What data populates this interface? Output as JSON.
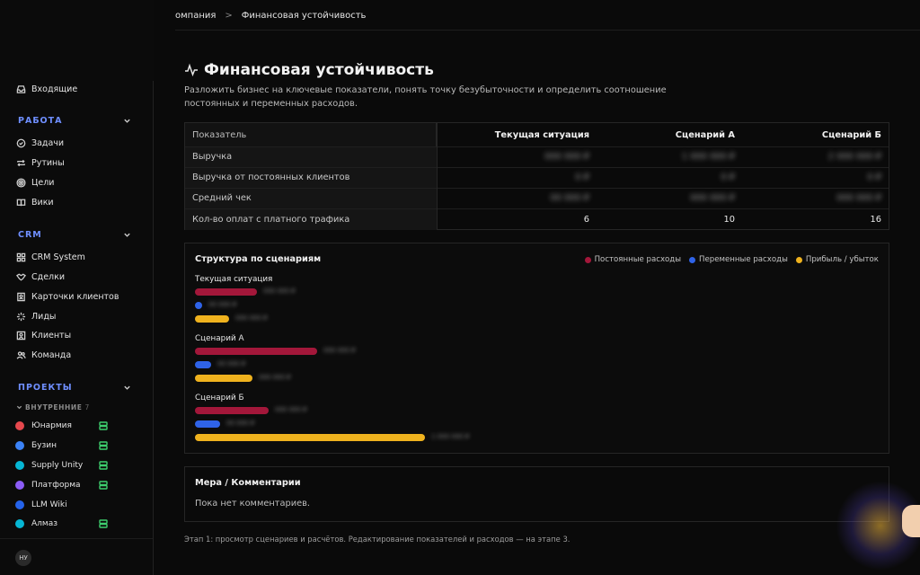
{
  "breadcrumb": {
    "parent": "омпания",
    "separator": ">",
    "current": "Финансовая устойчивость"
  },
  "sidebar": {
    "inbox": "Входящие",
    "work": {
      "title": "РАБОТА",
      "items": [
        "Задачи",
        "Рутины",
        "Цели",
        "Вики"
      ]
    },
    "crm": {
      "title": "CRM",
      "items": [
        "CRM System",
        "Сделки",
        "Карточки клиентов",
        "Лиды",
        "Клиенты",
        "Команда"
      ]
    },
    "projects": {
      "title": "ПРОЕКТЫ",
      "group": "ВНУТРЕННИЕ",
      "group_count": "7",
      "items": [
        {
          "name": "Юнармия",
          "color": "#e5484d",
          "server": true
        },
        {
          "name": "Бузин",
          "color": "#3b82f6",
          "server": true
        },
        {
          "name": "Supply Unity",
          "color": "#06b6d4",
          "server": true
        },
        {
          "name": "Платформа",
          "color": "#8b5cf6",
          "server": true
        },
        {
          "name": "LLM Wiki",
          "color": "#2563eb",
          "server": false
        },
        {
          "name": "Алмаз",
          "color": "#06b6d4",
          "server": true
        }
      ]
    },
    "avatar": "НУ"
  },
  "page": {
    "title": "Финансовая устойчивость",
    "description": "Разложить бизнес на ключевые показатели, понять точку безубыточности и определить соотношение постоянных и переменных расходов."
  },
  "table": {
    "headers": [
      "Показатель",
      "Текущая ситуация",
      "Сценарий А",
      "Сценарий Б"
    ],
    "rows": [
      {
        "label": "Выручка",
        "values": [
          "000 000 ₽",
          "1 000 000 ₽",
          "2 000 000 ₽"
        ],
        "hidden": true
      },
      {
        "label": "Выручка от постоянных клиентов",
        "values": [
          "0 ₽",
          "0 ₽",
          "0 ₽"
        ],
        "hidden": true
      },
      {
        "label": "Средний чек",
        "values": [
          "00 000 ₽",
          "000 000 ₽",
          "000 000 ₽"
        ],
        "hidden": true
      },
      {
        "label": "Кол-во оплат с платного трафика",
        "values": [
          "6",
          "10",
          "16"
        ],
        "hidden": false
      }
    ]
  },
  "chart_data": {
    "type": "bar",
    "title": "Структура по сценариям",
    "legend_position": "top-right",
    "series": [
      {
        "name": "Постоянные расходы",
        "color": "#a3173a"
      },
      {
        "name": "Переменные расходы",
        "color": "#2f63e8"
      },
      {
        "name": "Прибыль / убыток",
        "color": "#efb21e"
      }
    ],
    "categories": [
      "Текущая ситуация",
      "Сценарий А",
      "Сценарий Б"
    ],
    "max_value": 100,
    "values": [
      [
        27,
        3,
        15
      ],
      [
        53,
        7,
        25
      ],
      [
        32,
        11,
        100
      ]
    ],
    "value_labels": [
      [
        "000 000 ₽",
        "00 000 ₽",
        "000 000 ₽"
      ],
      [
        "000 000 ₽",
        "00 000 ₽",
        "000 000 ₽"
      ],
      [
        "000 000 ₽",
        "00 000 ₽",
        "1 000 000 ₽"
      ]
    ]
  },
  "comments": {
    "title": "Мера / Комментарии",
    "empty": "Пока нет комментариев."
  },
  "footnote": "Этап 1: просмотр сценариев и расчётов. Редактирование показателей и расходов — на этапе 3."
}
